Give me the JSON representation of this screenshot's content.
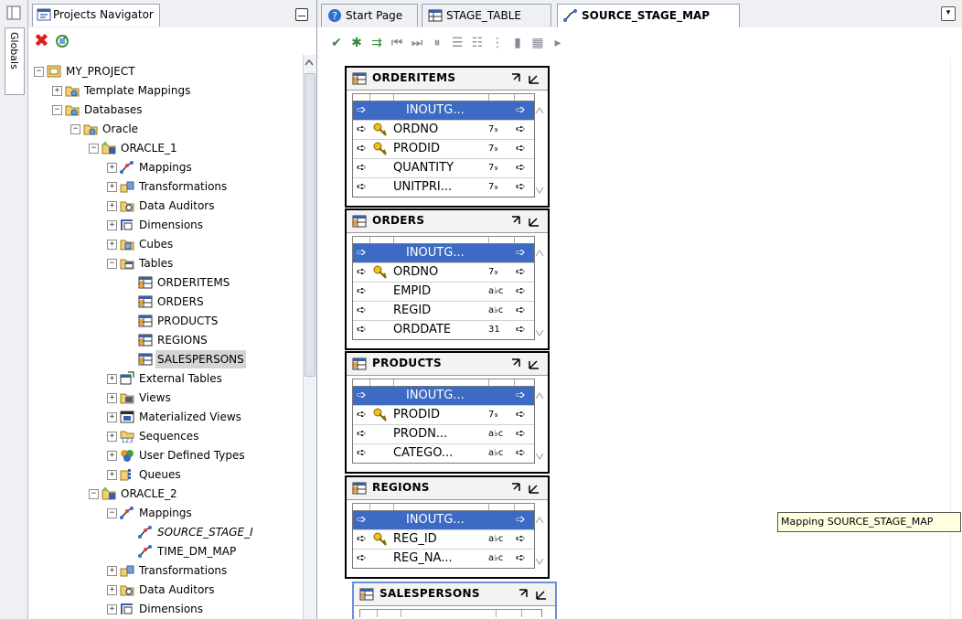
{
  "globals_tab": {
    "label": "Globals"
  },
  "navigator": {
    "tab_label": "Projects Navigator",
    "tree": [
      {
        "label": "MY_PROJECT",
        "level": 0,
        "exp": "minus",
        "icon": "project-icon"
      },
      {
        "label": "Template Mappings",
        "level": 1,
        "exp": "plus",
        "icon": "folder-icon"
      },
      {
        "label": "Databases",
        "level": 1,
        "exp": "minus",
        "icon": "folder-icon"
      },
      {
        "label": "Oracle",
        "level": 2,
        "exp": "minus",
        "icon": "folder-icon"
      },
      {
        "label": "ORACLE_1",
        "level": 3,
        "exp": "minus",
        "icon": "module-icon"
      },
      {
        "label": "Mappings",
        "level": 4,
        "exp": "plus",
        "icon": "mapping-icon"
      },
      {
        "label": "Transformations",
        "level": 4,
        "exp": "plus",
        "icon": "transformation-icon"
      },
      {
        "label": "Data Auditors",
        "level": 4,
        "exp": "plus",
        "icon": "auditor-icon"
      },
      {
        "label": "Dimensions",
        "level": 4,
        "exp": "plus",
        "icon": "dimension-icon"
      },
      {
        "label": "Cubes",
        "level": 4,
        "exp": "plus",
        "icon": "cube-icon"
      },
      {
        "label": "Tables",
        "level": 4,
        "exp": "minus",
        "icon": "tables-folder-icon"
      },
      {
        "label": "ORDERITEMS",
        "level": 5,
        "exp": "",
        "icon": "table-icon"
      },
      {
        "label": "ORDERS",
        "level": 5,
        "exp": "",
        "icon": "table-icon"
      },
      {
        "label": "PRODUCTS",
        "level": 5,
        "exp": "",
        "icon": "table-icon"
      },
      {
        "label": "REGIONS",
        "level": 5,
        "exp": "",
        "icon": "table-icon"
      },
      {
        "label": "SALESPERSONS",
        "level": 5,
        "exp": "",
        "icon": "table-icon",
        "selected": true
      },
      {
        "label": "External Tables",
        "level": 4,
        "exp": "plus",
        "icon": "external-table-icon"
      },
      {
        "label": "Views",
        "level": 4,
        "exp": "plus",
        "icon": "views-icon"
      },
      {
        "label": "Materialized Views",
        "level": 4,
        "exp": "plus",
        "icon": "mview-icon"
      },
      {
        "label": "Sequences",
        "level": 4,
        "exp": "plus",
        "icon": "sequence-icon"
      },
      {
        "label": "User Defined Types",
        "level": 4,
        "exp": "plus",
        "icon": "udt-icon"
      },
      {
        "label": "Queues",
        "level": 4,
        "exp": "plus",
        "icon": "queue-icon"
      },
      {
        "label": "ORACLE_2",
        "level": 3,
        "exp": "minus",
        "icon": "module-icon"
      },
      {
        "label": "Mappings",
        "level": 4,
        "exp": "minus",
        "icon": "mapping-icon"
      },
      {
        "label": "SOURCE_STAGE_I",
        "level": 5,
        "exp": "",
        "icon": "mapping-icon",
        "italic": true
      },
      {
        "label": "TIME_DM_MAP",
        "level": 5,
        "exp": "",
        "icon": "mapping-icon"
      },
      {
        "label": "Transformations",
        "level": 4,
        "exp": "plus",
        "icon": "transformation-icon"
      },
      {
        "label": "Data Auditors",
        "level": 4,
        "exp": "plus",
        "icon": "auditor-icon"
      },
      {
        "label": "Dimensions",
        "level": 4,
        "exp": "plus",
        "icon": "dimension-icon"
      }
    ]
  },
  "editor": {
    "tabs": [
      {
        "label": "Start Page",
        "icon": "help-icon"
      },
      {
        "label": "STAGE_TABLE",
        "icon": "table-icon"
      },
      {
        "label": "SOURCE_STAGE_MAP",
        "icon": "mapping-icon",
        "active": true
      }
    ]
  },
  "operators": [
    {
      "title": "ORDERITEMS",
      "group": "INOUTG...",
      "rows": [
        {
          "name": "ORDNO",
          "key": true,
          "type": "7₉"
        },
        {
          "name": "PRODID",
          "key": true,
          "type": "7₉"
        },
        {
          "name": "QUANTITY",
          "key": false,
          "type": "7₉"
        },
        {
          "name": "UNITPRI...",
          "key": false,
          "type": "7₉"
        }
      ]
    },
    {
      "title": "ORDERS",
      "group": "INOUTG...",
      "rows": [
        {
          "name": "ORDNO",
          "key": true,
          "type": "7₉"
        },
        {
          "name": "EMPID",
          "key": false,
          "type": "a♭ᴄ"
        },
        {
          "name": "REGID",
          "key": false,
          "type": "a♭ᴄ"
        },
        {
          "name": "ORDDATE",
          "key": false,
          "type": "31"
        }
      ]
    },
    {
      "title": "PRODUCTS",
      "group": "INOUTG...",
      "rows": [
        {
          "name": "PRODID",
          "key": true,
          "type": "7₉"
        },
        {
          "name": "PRODN...",
          "key": false,
          "type": "a♭ᴄ"
        },
        {
          "name": "CATEGO...",
          "key": false,
          "type": "a♭ᴄ"
        }
      ]
    },
    {
      "title": "REGIONS",
      "group": "INOUTG...",
      "rows": [
        {
          "name": "REG_ID",
          "key": true,
          "type": "a♭ᴄ"
        },
        {
          "name": "REG_NA...",
          "key": false,
          "type": "a♭ᴄ"
        }
      ]
    },
    {
      "title": "SALESPERSONS",
      "group": "",
      "rows": []
    }
  ],
  "tooltip": "Mapping SOURCE_STAGE_MAP",
  "colors": {
    "selection_blue": "#3c6ac4",
    "tooltip_bg": "#ffffe1",
    "delete_red": "#d8231c"
  }
}
